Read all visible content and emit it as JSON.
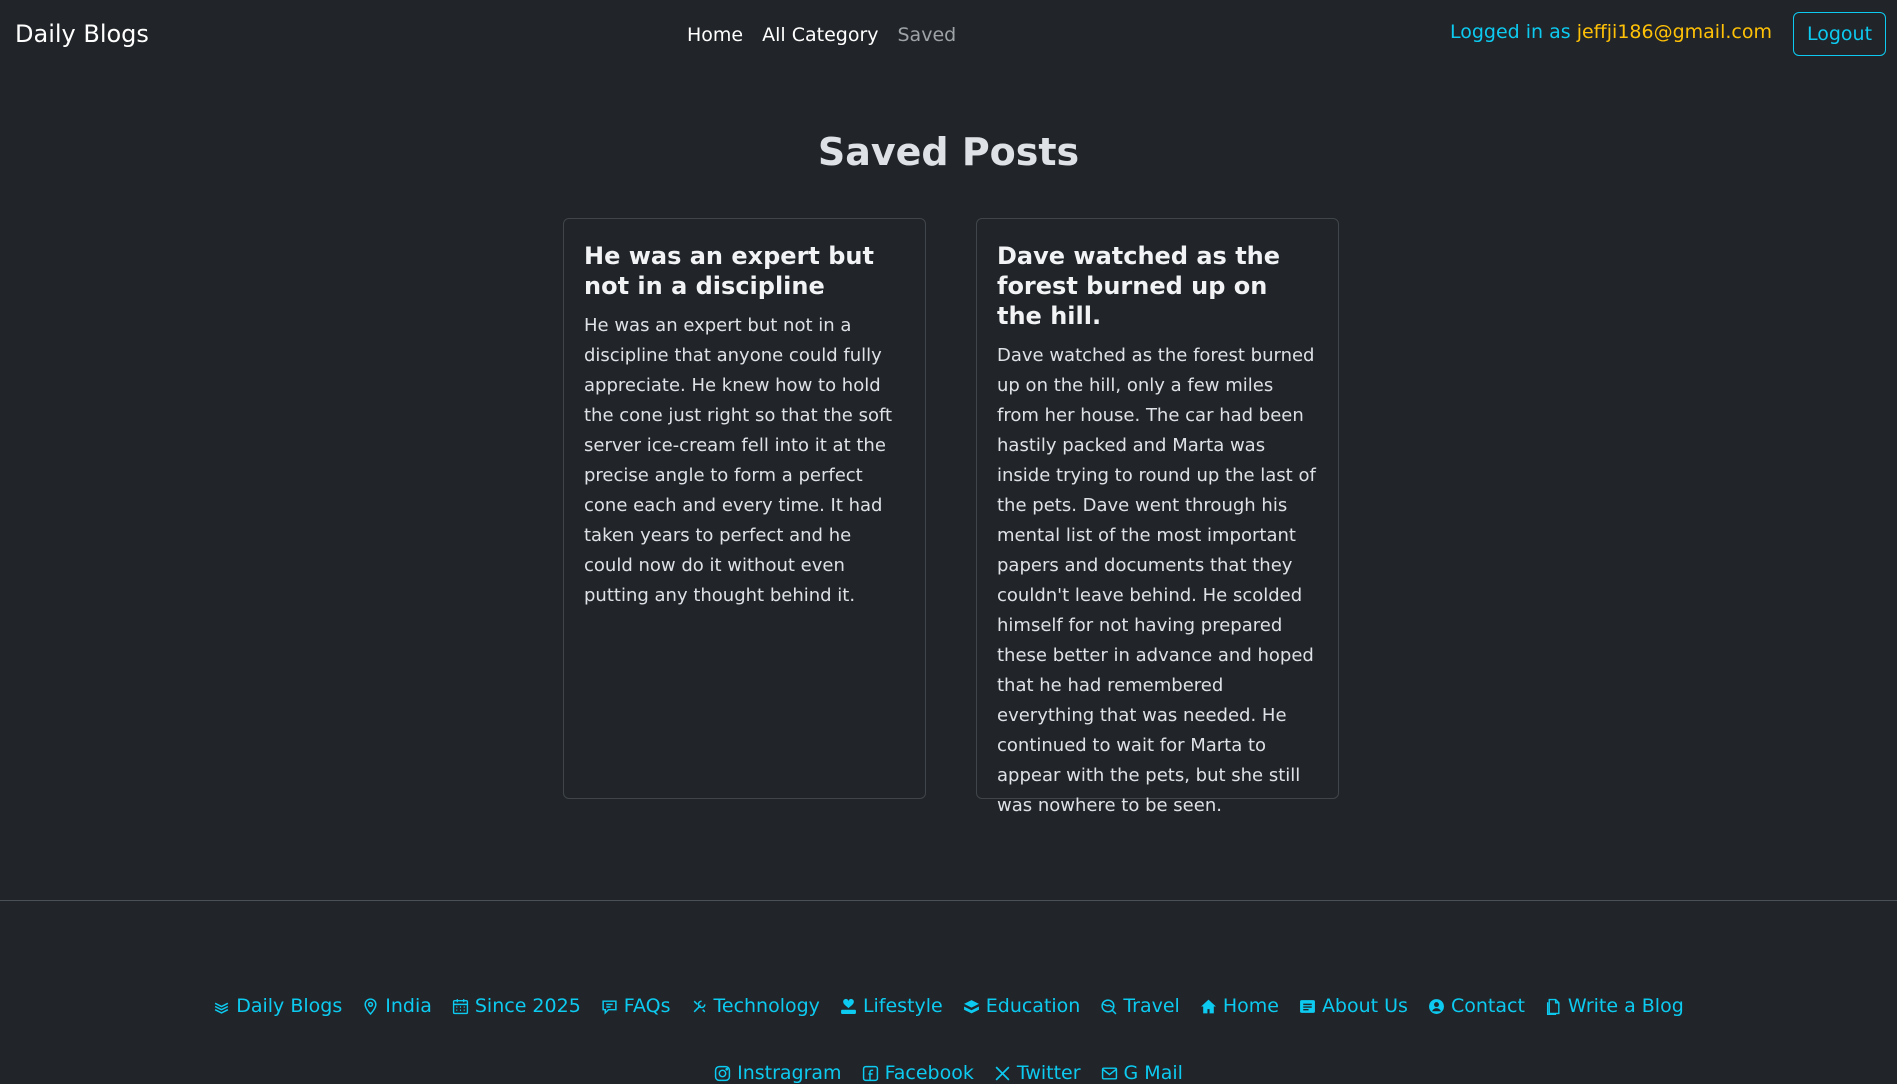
{
  "navbar": {
    "brand": "Daily Blogs",
    "links": [
      "Home",
      "All Category",
      "Saved"
    ],
    "login_prefix": "Logged in as",
    "login_email": "jeffji186@gmail.com",
    "logout_label": "Logout"
  },
  "main": {
    "title": "Saved Posts",
    "cards": [
      {
        "title": "He was an expert but not in a discipline",
        "body": "He was an expert but not in a discipline that anyone could fully appreciate. He knew how to hold the cone just right so that the soft server ice-cream fell into it at the precise angle to form a perfect cone each and every time. It had taken years to perfect and he could now do it without even putting any thought behind it."
      },
      {
        "title": "Dave watched as the forest burned up on the hill.",
        "body": "Dave watched as the forest burned up on the hill, only a few miles from her house. The car had been hastily packed and Marta was inside trying to round up the last of the pets. Dave went through his mental list of the most important papers and documents that they couldn't leave behind. He scolded himself for not having prepared these better in advance and hoped that he had remembered everything that was needed. He continued to wait for Marta to appear with the pets, but she still was nowhere to be seen."
      }
    ]
  },
  "footer": {
    "row1": [
      {
        "icon": "blog-logo-icon",
        "label": "Daily Blogs"
      },
      {
        "icon": "location-pin-icon",
        "label": "India"
      },
      {
        "icon": "calendar-icon",
        "label": "Since 2025"
      },
      {
        "icon": "chat-icon",
        "label": "FAQs"
      },
      {
        "icon": "tools-icon",
        "label": "Technology"
      },
      {
        "icon": "heart-hand-icon",
        "label": "Lifestyle"
      },
      {
        "icon": "book-icon",
        "label": "Education"
      },
      {
        "icon": "globe-icon",
        "label": "Travel"
      },
      {
        "icon": "home-icon",
        "label": "Home"
      },
      {
        "icon": "card-text-icon",
        "label": "About Us"
      },
      {
        "icon": "person-icon",
        "label": "Contact"
      },
      {
        "icon": "document-icon",
        "label": "Write a Blog"
      }
    ],
    "row2": [
      {
        "icon": "instagram-icon",
        "label": "Instragram"
      },
      {
        "icon": "facebook-icon",
        "label": "Facebook"
      },
      {
        "icon": "x-twitter-icon",
        "label": "Twitter"
      },
      {
        "icon": "mail-icon",
        "label": "G Mail"
      }
    ]
  },
  "colors": {
    "background": "#212529",
    "accent": "#0dcaf0",
    "email": "#ffc107"
  }
}
